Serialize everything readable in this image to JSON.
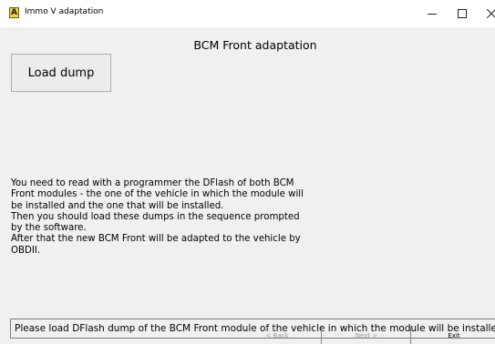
{
  "window": {
    "icon_letter": "A",
    "title": "Immo V adaptation",
    "controls": [
      "minimize",
      "maximize",
      "close"
    ]
  },
  "main": {
    "heading": "BCM Front adaptation",
    "load_button_label": "Load dump",
    "instructions": "You need to read with a programmer the DFlash of both BCM\nFront modules - the one of the vehicle in which the module will\nbe installed and the one that will be installed.\nThen you should load these dumps in the sequence prompted\nby the software.\nAfter that the new BCM Front will be adapted to the vehicle by\nOBDII.",
    "status_message": "Please load DFlash dump of the BCM Front module of the vehicle in which the module will be installed."
  },
  "footer": {
    "back_label": "< Back",
    "next_label": "Next >",
    "exit_label": "Exit"
  },
  "colors": {
    "window_bg": "#f0f0f0",
    "titlebar_bg": "#ffffff",
    "disabled_text": "#9a9a9a",
    "icon_yellow": "#f7d23d"
  }
}
